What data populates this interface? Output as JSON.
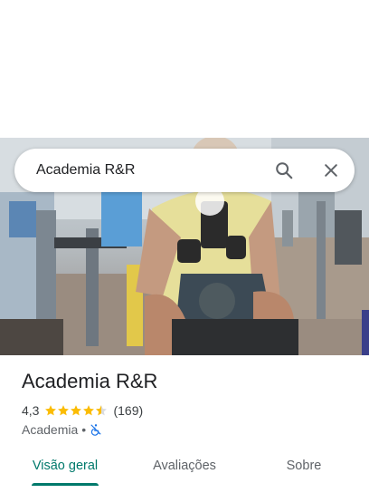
{
  "search": {
    "query": "Academia R&R",
    "search_icon": "search-icon",
    "close_icon": "close-icon"
  },
  "place": {
    "name": "Academia R&R",
    "rating": "4,3",
    "rating_value": 4.3,
    "rating_max": 5,
    "reviews_count": "(169)",
    "category": "Academia",
    "separator": "•",
    "accessibility_icon": "not-accessible-icon"
  },
  "tabs": [
    {
      "label": "Visão geral",
      "active": true
    },
    {
      "label": "Avaliações",
      "active": false
    },
    {
      "label": "Sobre",
      "active": false
    }
  ],
  "colors": {
    "accent": "#00796b",
    "star": "#fbbc04",
    "accessibility_icon": "#1a73e8"
  }
}
